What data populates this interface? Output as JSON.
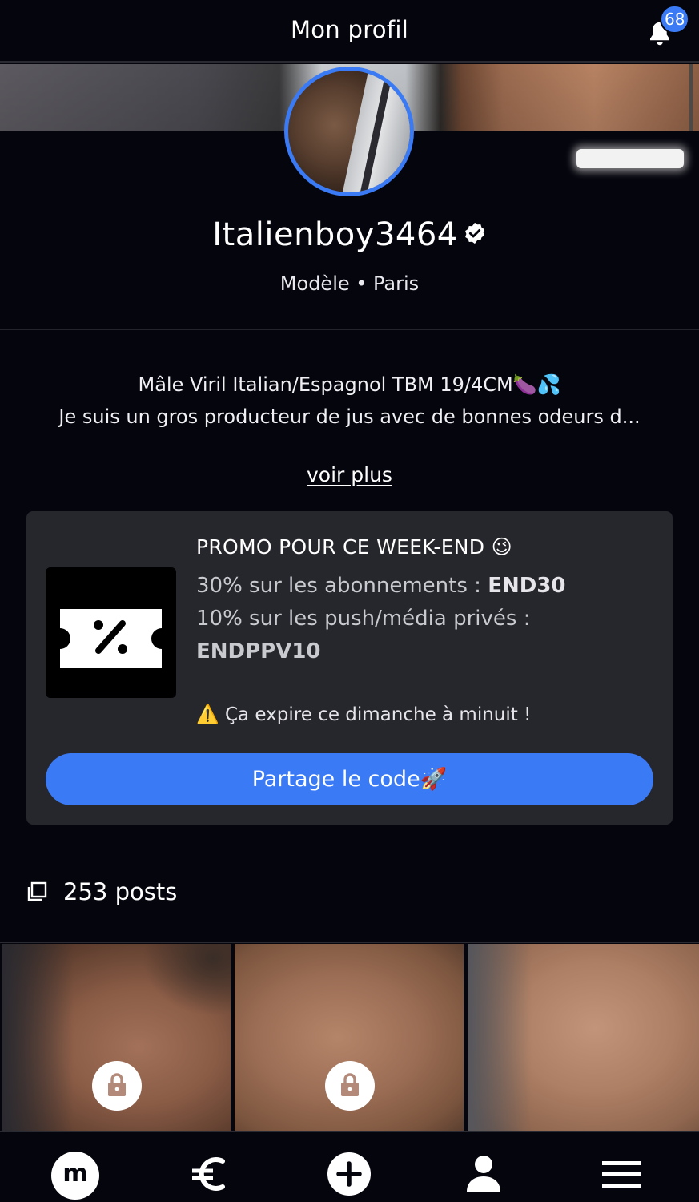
{
  "header": {
    "title": "Mon profil",
    "notification_count": "68"
  },
  "profile": {
    "username": "Italienboy3464",
    "subtitle": "Modèle • Paris",
    "bio_line1": "Mâle Viril Italian/Espagnol TBM 19/4CM🍆💦",
    "bio_line2": "Je suis un gros producteur de jus avec de bonnes odeurs d...",
    "see_more": "voir plus"
  },
  "promo": {
    "title": "PROMO POUR CE WEEK-END 😉",
    "line1_text": "30% sur les abonnements : ",
    "line1_code": "END30",
    "line2_text": "10% sur les push/média privés :",
    "line2_code": "ENDPPV10",
    "warning": "⚠️ Ça expire ce dimanche à minuit !",
    "share_button": "Partage le code🚀"
  },
  "posts": {
    "label": "253 posts"
  },
  "bottom_nav": {
    "home_label": "m",
    "icons": [
      "home-m-icon",
      "euro-icon",
      "add-icon",
      "profile-icon",
      "menu-icon"
    ]
  },
  "colors": {
    "accent": "#3a7bf5",
    "background": "#05050d",
    "card": "#26262d"
  }
}
